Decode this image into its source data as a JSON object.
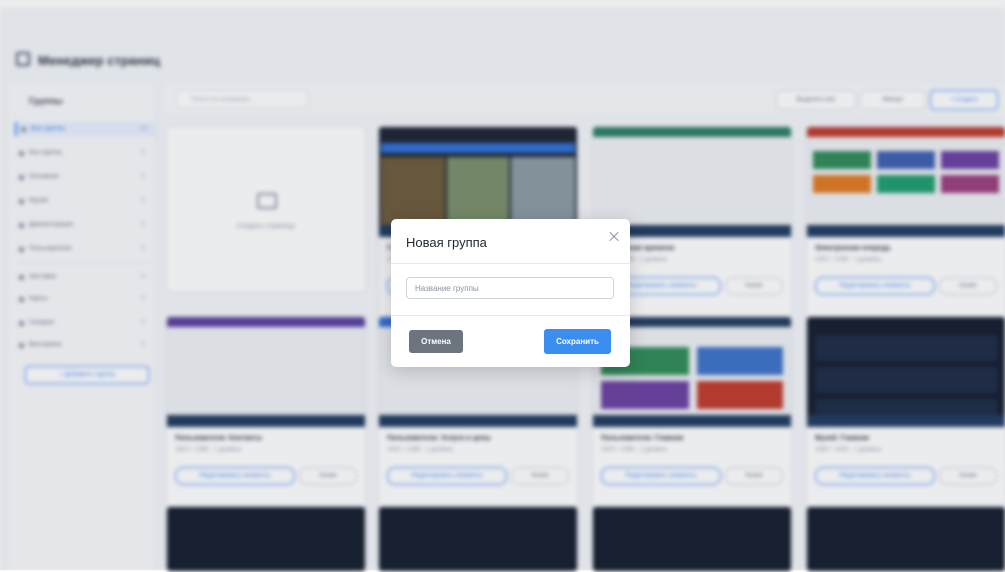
{
  "modal": {
    "title": "Новая группа",
    "input_placeholder": "Название группы",
    "input_value": "",
    "cancel_label": "Отмена",
    "save_label": "Сохранить",
    "close_icon": "close-icon"
  },
  "colors": {
    "primary": "#3b8ef0",
    "secondary": "#6c757d",
    "thumb_bar": "#1f3a5f",
    "overlay": "rgba(60,70,90,0.10)"
  }
}
